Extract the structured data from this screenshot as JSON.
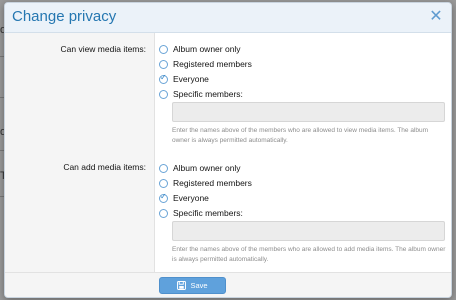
{
  "background": {
    "fragments": [
      "o",
      "o",
      "T"
    ]
  },
  "modal": {
    "title": "Change privacy",
    "close_icon": "close-icon",
    "sections": [
      {
        "label": "Can view media items:",
        "options": [
          {
            "label": "Album owner only",
            "checked": false
          },
          {
            "label": "Registered members",
            "checked": false
          },
          {
            "label": "Everyone",
            "checked": true
          },
          {
            "label": "Specific members:",
            "checked": false
          }
        ],
        "members_value": "",
        "hint": "Enter the names above of the members who are allowed to view media items. The album owner is always permitted automatically."
      },
      {
        "label": "Can add media items:",
        "options": [
          {
            "label": "Album owner only",
            "checked": false
          },
          {
            "label": "Registered members",
            "checked": false
          },
          {
            "label": "Everyone",
            "checked": true
          },
          {
            "label": "Specific members:",
            "checked": false
          }
        ],
        "members_value": "",
        "hint": "Enter the names above of the members who are allowed to add media items. The album owner is always permitted automatically."
      }
    ],
    "save_label": "Save",
    "save_icon": "save-icon"
  },
  "colors": {
    "accent": "#2577b1",
    "button": "#5fa1dc",
    "header_bg": "#ebf2f9"
  }
}
